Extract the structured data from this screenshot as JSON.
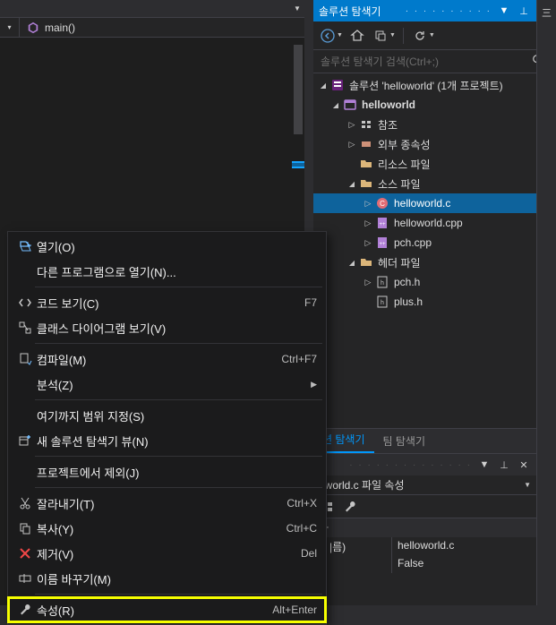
{
  "editor": {
    "scope_label": "main()",
    "scope_icon": "method-icon"
  },
  "solution_explorer": {
    "title": "솔루션 탐색기",
    "search_placeholder": "솔루션 탐색기 검색(Ctrl+;)",
    "tree": [
      {
        "depth": 0,
        "exp": "open",
        "icon": "solution-icon",
        "label": "솔루션 'helloworld' (1개 프로젝트)"
      },
      {
        "depth": 1,
        "exp": "open",
        "icon": "project-icon",
        "label": "helloworld",
        "bold": true
      },
      {
        "depth": 2,
        "exp": "closed",
        "icon": "references-icon",
        "label": "참조"
      },
      {
        "depth": 2,
        "exp": "closed",
        "icon": "refs-ext-icon",
        "label": "외부 종속성"
      },
      {
        "depth": 2,
        "exp": "none",
        "icon": "folder-icon",
        "label": "리소스 파일"
      },
      {
        "depth": 2,
        "exp": "open",
        "icon": "folder-icon",
        "label": "소스 파일"
      },
      {
        "depth": 3,
        "exp": "closed",
        "icon": "c-file-icon",
        "label": "helloworld.c",
        "selected": true
      },
      {
        "depth": 3,
        "exp": "closed",
        "icon": "cpp-file-icon",
        "label": "helloworld.cpp"
      },
      {
        "depth": 3,
        "exp": "closed",
        "icon": "cpp-file-icon",
        "label": "pch.cpp"
      },
      {
        "depth": 2,
        "exp": "open",
        "icon": "folder-icon",
        "label": "헤더 파일"
      },
      {
        "depth": 3,
        "exp": "closed",
        "icon": "h-file-icon",
        "label": "pch.h"
      },
      {
        "depth": 3,
        "exp": "none",
        "icon": "h-file-icon",
        "label": "plus.h"
      }
    ],
    "bottom_tabs": {
      "active_partial": "션 탐색기",
      "inactive": "팀 탐색기"
    }
  },
  "properties": {
    "title_partial": "",
    "object_label": "oworld.c 파일 속성",
    "category_partial": "타",
    "rows": [
      {
        "key": "|름)",
        "val": "helloworld.c"
      },
      {
        "key": "",
        "val": "False"
      }
    ]
  },
  "context_menu": {
    "items": [
      {
        "icon": "open-icon",
        "label": "열기(O)",
        "shortcut": "",
        "sub": false
      },
      {
        "icon": "",
        "label": "다른 프로그램으로 열기(N)...",
        "shortcut": "",
        "sub": false
      },
      {
        "sep": true
      },
      {
        "icon": "code-icon",
        "label": "코드 보기(C)",
        "shortcut": "F7",
        "sub": false
      },
      {
        "icon": "classdiag-icon",
        "label": "클래스 다이어그램 보기(V)",
        "shortcut": "",
        "sub": false
      },
      {
        "sep": true
      },
      {
        "icon": "compile-icon",
        "label": "컴파일(M)",
        "shortcut": "Ctrl+F7",
        "sub": false
      },
      {
        "icon": "",
        "label": "분석(Z)",
        "shortcut": "",
        "sub": true
      },
      {
        "sep": true
      },
      {
        "icon": "",
        "label": "여기까지 범위 지정(S)",
        "shortcut": "",
        "sub": false
      },
      {
        "icon": "newview-icon",
        "label": "새 솔루션 탐색기 뷰(N)",
        "shortcut": "",
        "sub": false
      },
      {
        "sep": true
      },
      {
        "icon": "",
        "label": "프로젝트에서 제외(J)",
        "shortcut": "",
        "sub": false
      },
      {
        "sep": true
      },
      {
        "icon": "cut-icon",
        "label": "잘라내기(T)",
        "shortcut": "Ctrl+X",
        "sub": false
      },
      {
        "icon": "copy-icon",
        "label": "복사(Y)",
        "shortcut": "Ctrl+C",
        "sub": false
      },
      {
        "icon": "delete-icon",
        "label": "제거(V)",
        "shortcut": "Del",
        "sub": false
      },
      {
        "icon": "rename-icon",
        "label": "이름 바꾸기(M)",
        "shortcut": "",
        "sub": false
      },
      {
        "sep": true
      },
      {
        "icon": "wrench-icon",
        "label": "속성(R)",
        "shortcut": "Alt+Enter",
        "sub": false,
        "highlight": true
      }
    ]
  }
}
